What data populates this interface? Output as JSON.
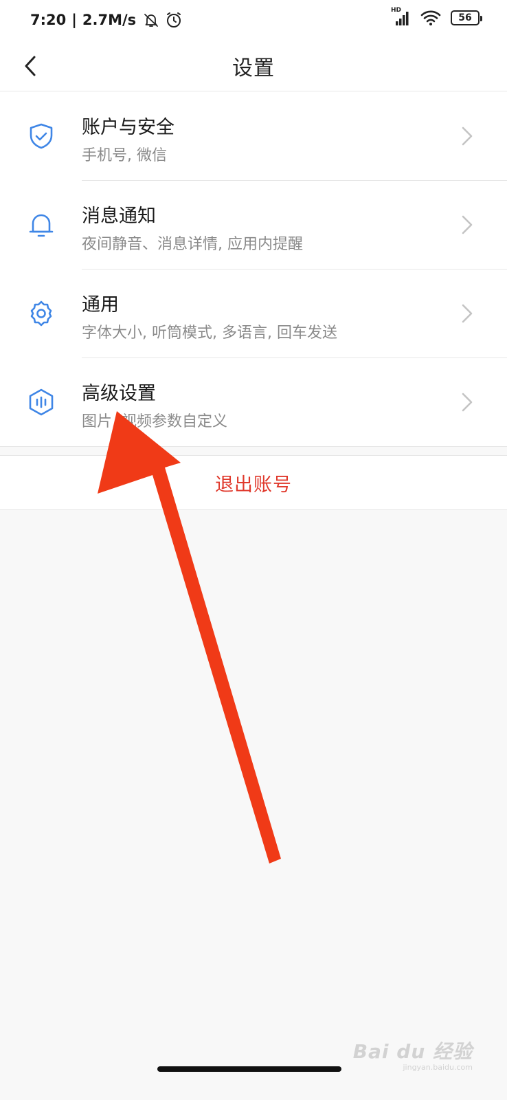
{
  "status_bar": {
    "time": "7:20",
    "separator": "|",
    "net_speed": "2.7M/s",
    "icons": [
      "silent-bell-icon",
      "alarm-icon",
      "signal-icon",
      "wifi-icon",
      "battery-icon"
    ],
    "signal_label": "HD",
    "battery": "56"
  },
  "nav": {
    "title": "设置",
    "back_icon": "chevron-left-icon"
  },
  "settings": [
    {
      "title": "账户与安全",
      "subtitle": "手机号, 微信",
      "icon": "shield-check-icon"
    },
    {
      "title": "消息通知",
      "subtitle": "夜间静音、消息详情, 应用内提醒",
      "icon": "bell-icon"
    },
    {
      "title": "通用",
      "subtitle": "字体大小, 听筒模式, 多语言, 回车发送",
      "icon": "gear-icon"
    },
    {
      "title": "高级设置",
      "subtitle": "图片, 视频参数自定义",
      "icon": "hexagon-bars-icon"
    }
  ],
  "logout": {
    "label": "退出账号"
  },
  "watermark": {
    "logo": "Bai du 经验",
    "url": "jingyan.baidu.com"
  },
  "colors": {
    "accent_blue": "#3f86e6",
    "logout_red": "#e0392c",
    "annotation_red": "#f03a17",
    "background": "#f8f8f8"
  }
}
